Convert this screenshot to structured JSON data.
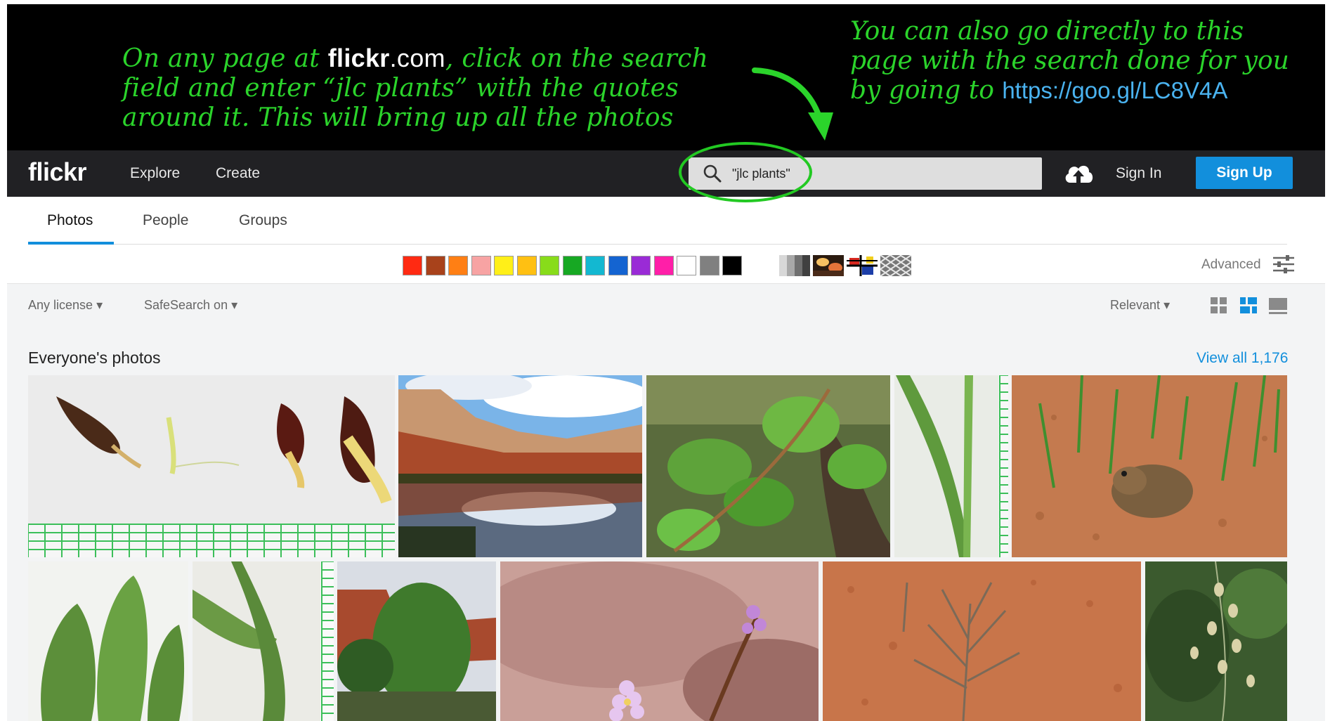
{
  "annotation": {
    "left_prefix": "On any page at",
    "left_brand": "flickr",
    "left_brand_suffix": ".com",
    "left_suffix": ", click on the search field and enter “jlc plants” with the quotes around it. This will bring up all the photos",
    "right_text": "You can also go directly to this page with the search done for you by going to",
    "right_link": "https://goo.gl/LC8V4A"
  },
  "nav": {
    "logo": "flickr",
    "explore": "Explore",
    "create": "Create",
    "search_value": "\"jlc plants\"",
    "sign_in": "Sign In",
    "sign_up": "Sign Up"
  },
  "tabs": [
    {
      "label": "Photos"
    },
    {
      "label": "People"
    },
    {
      "label": "Groups"
    }
  ],
  "colors": [
    "#ff2a12",
    "#a8421b",
    "#ff7f14",
    "#f7a3a3",
    "#ffef18",
    "#ffc012",
    "#88dc1a",
    "#17a823",
    "#13b8d1",
    "#1464d1",
    "#9a2bd6",
    "#ff1fa8",
    "#ffffff",
    "#808080",
    "#000000"
  ],
  "filters": {
    "advanced": "Advanced",
    "license": "Any license",
    "safesearch": "SafeSearch on",
    "sort": "Relevant"
  },
  "section": {
    "title": "Everyone's photos",
    "view_all": "View all 1,176"
  }
}
